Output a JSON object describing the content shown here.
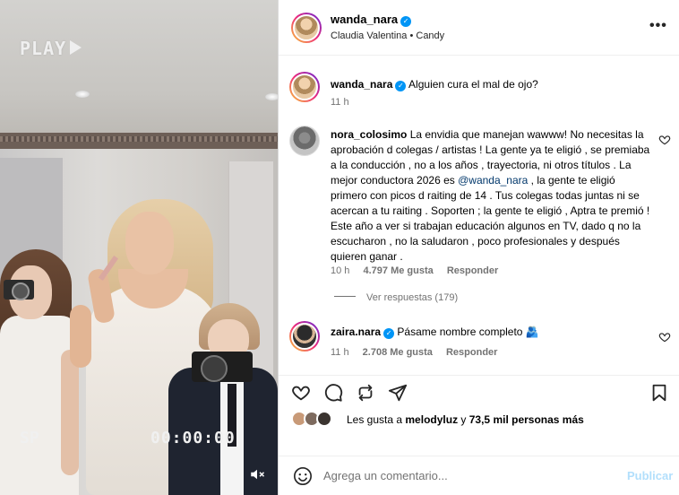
{
  "media": {
    "overlay_play": "PLAY",
    "overlay_sp": "SP",
    "overlay_timecode": "00:00:00"
  },
  "header": {
    "username": "wanda_nara",
    "subtitle": "Claudia Valentina • Candy",
    "more_icon": "more-horizontal-icon"
  },
  "caption": {
    "username": "wanda_nara",
    "text": "Alguien cura el mal de ojo?",
    "time": "11 h"
  },
  "comments": [
    {
      "username": "nora_colosimo",
      "text_before": "La envidia que manejan wawww! No necesitas la aprobación d colegas / artistas ! La gente ya te eligió , se premiaba a la conducción , no a los años , trayectoria, ni otros títulos . La mejor conductora 2026 es ",
      "mention": "@wanda_nara",
      "text_after": " , la gente te eligió primero con picos d raiting de 14 . Tus colegas todas juntas ni se acercan a tu raiting . Soporten ; la gente te eligió , Aptra te premió ! Este año a ver si trabajan educación algunos en TV, dado q no la escucharon , no la saludaron , poco profesionales y después quieren ganar .",
      "time": "10 h",
      "likes": "4.797 Me gusta",
      "reply": "Responder",
      "view_replies": "Ver respuestas (179)"
    },
    {
      "username": "zaira.nara",
      "text": "Pásame nombre completo",
      "emoji": "🫂",
      "time": "11 h",
      "likes": "2.708 Me gusta",
      "reply": "Responder"
    }
  ],
  "likes": {
    "prefix": "Les gusta a ",
    "user": "melodyluz",
    "middle": " y ",
    "count": "73,5 mil personas más"
  },
  "add_comment": {
    "placeholder": "Agrega un comentario...",
    "publish": "Publicar"
  },
  "colors": {
    "verified": "#0095f6",
    "mention": "#00376b",
    "publish_disabled": "#b2dffc",
    "meta_gray": "#737373"
  }
}
